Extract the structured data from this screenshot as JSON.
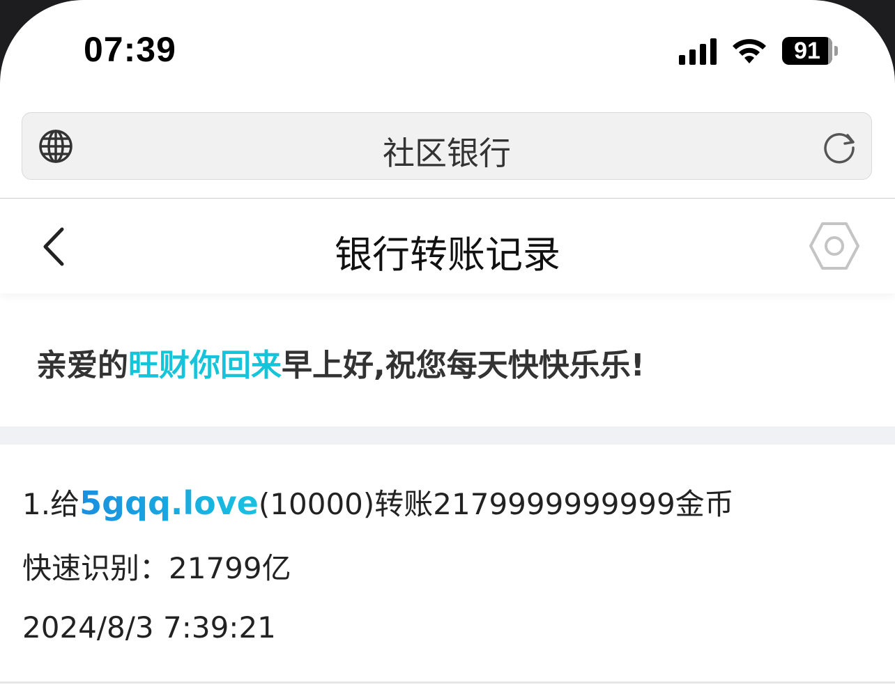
{
  "status_bar": {
    "time": "07:39",
    "battery": "91"
  },
  "browser": {
    "page_title": "社区银行"
  },
  "header": {
    "title": "银行转账记录"
  },
  "greeting": {
    "prefix": "亲爱的",
    "name": "旺财你回来",
    "suffix": "早上好,祝您每天快快乐乐!"
  },
  "record": {
    "index_prefix": "1.给",
    "recipient": "5gqq.love",
    "detail": "(10000)转账2179999999999金币",
    "quick_label": "快速识别：",
    "quick_value": "21799亿",
    "timestamp": "2024/8/3 7:39:21"
  },
  "colors": {
    "accent_name": "#16c4d9",
    "recipient_link": "#1aa6e0"
  },
  "icons": {
    "globe": "globe-icon",
    "reload": "reload-icon",
    "back": "chevron-left-icon",
    "settings": "hexagon-settings-icon"
  }
}
